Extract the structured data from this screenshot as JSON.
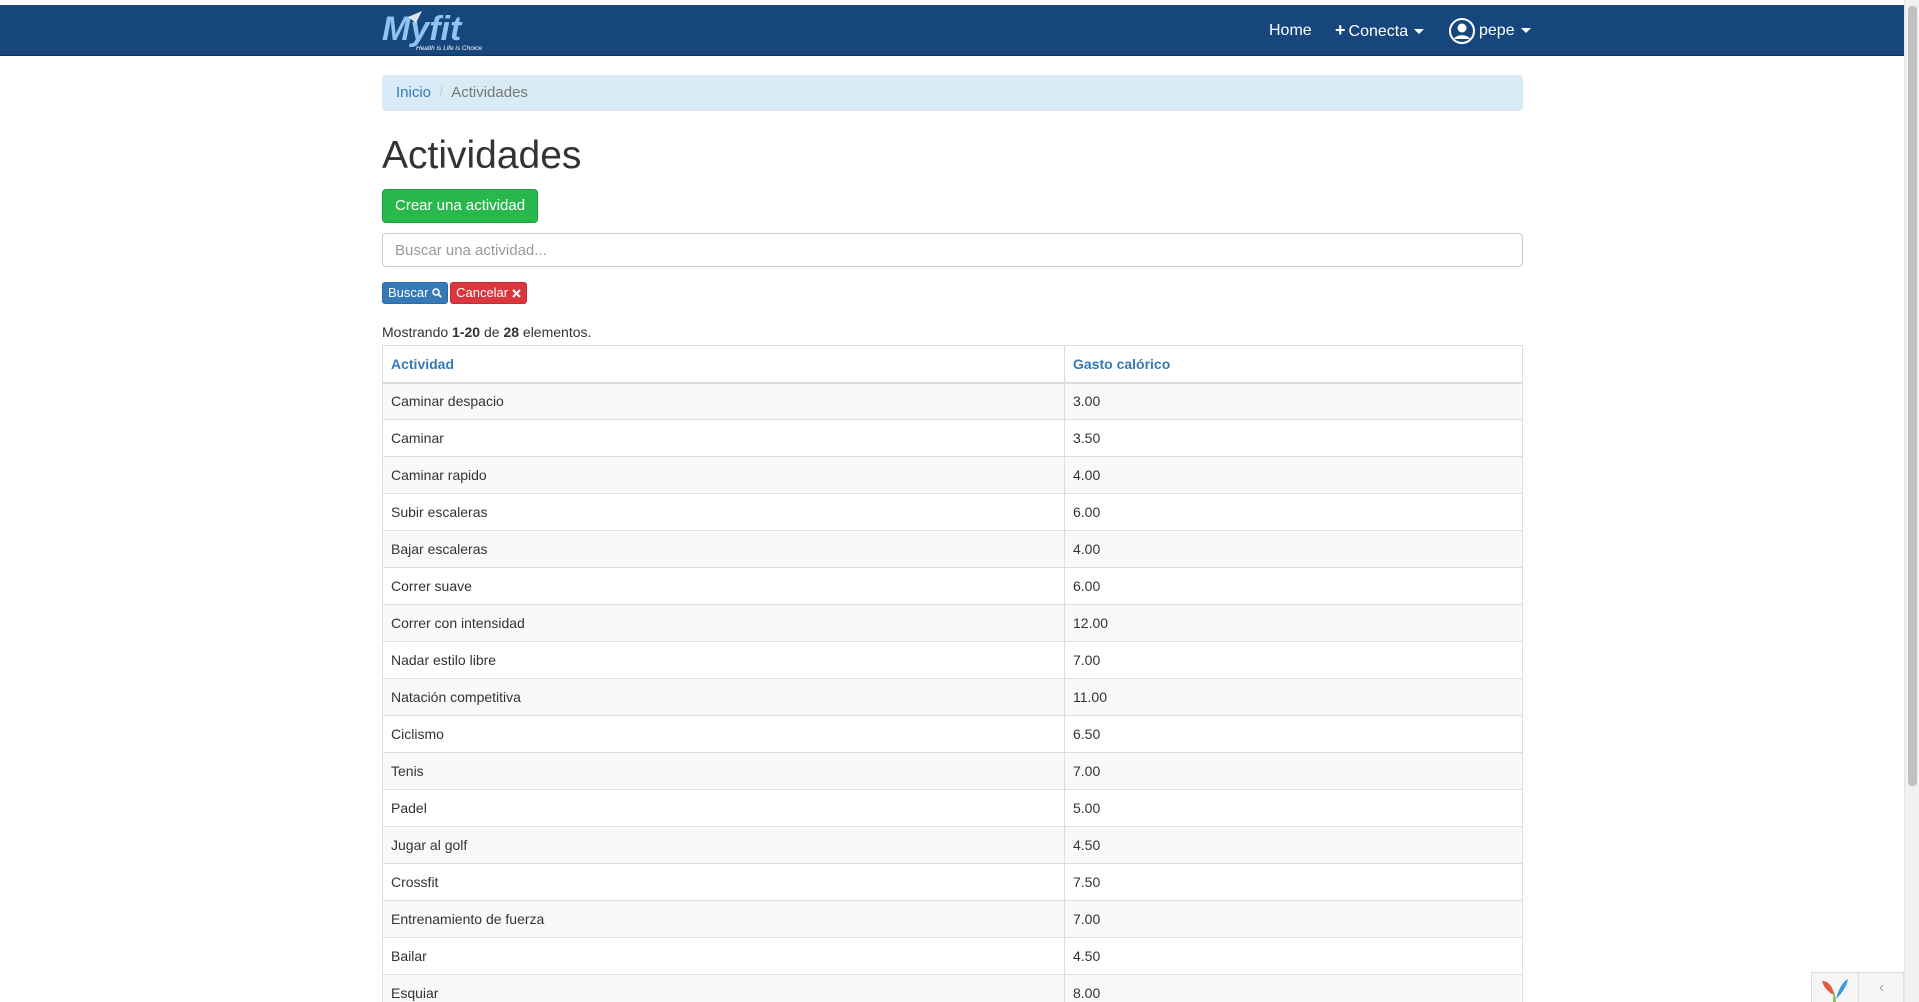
{
  "navbar": {
    "logo_text": "Myfit",
    "logo_tagline": "Health is Life is Choice",
    "home": "Home",
    "conecta": "Conecta",
    "user": "pepe"
  },
  "breadcrumb": {
    "home": "Inicio",
    "current": "Actividades"
  },
  "page": {
    "title": "Actividades",
    "create_button": "Crear una actividad",
    "search_placeholder": "Buscar una actividad...",
    "search_button": "Buscar",
    "cancel_button": "Cancelar"
  },
  "summary": {
    "prefix": "Mostrando ",
    "range": "1-20",
    "middle": " de ",
    "total": "28",
    "suffix": " elementos."
  },
  "table": {
    "headers": [
      "Actividad",
      "Gasto calórico"
    ],
    "rows": [
      [
        "Caminar despacio",
        "3.00"
      ],
      [
        "Caminar",
        "3.50"
      ],
      [
        "Caminar rapido",
        "4.00"
      ],
      [
        "Subir escaleras",
        "6.00"
      ],
      [
        "Bajar escaleras",
        "4.00"
      ],
      [
        "Correr suave",
        "6.00"
      ],
      [
        "Correr con intensidad",
        "12.00"
      ],
      [
        "Nadar estilo libre",
        "7.00"
      ],
      [
        "Natación competitiva",
        "11.00"
      ],
      [
        "Ciclismo",
        "6.50"
      ],
      [
        "Tenis",
        "7.00"
      ],
      [
        "Padel",
        "5.00"
      ],
      [
        "Jugar al golf",
        "4.50"
      ],
      [
        "Crossfit",
        "7.50"
      ],
      [
        "Entrenamiento de fuerza",
        "7.00"
      ],
      [
        "Bailar",
        "4.50"
      ],
      [
        "Esquiar",
        "8.00"
      ]
    ]
  },
  "toolbar": {
    "toggle": "‹"
  },
  "colors": {
    "navbar": "#17467d",
    "breadcrumb_bg": "#d9ebf6",
    "create_button": "#28b84c",
    "search_button": "#337ab7",
    "cancel_button": "#d9363e",
    "link": "#337ab7"
  }
}
